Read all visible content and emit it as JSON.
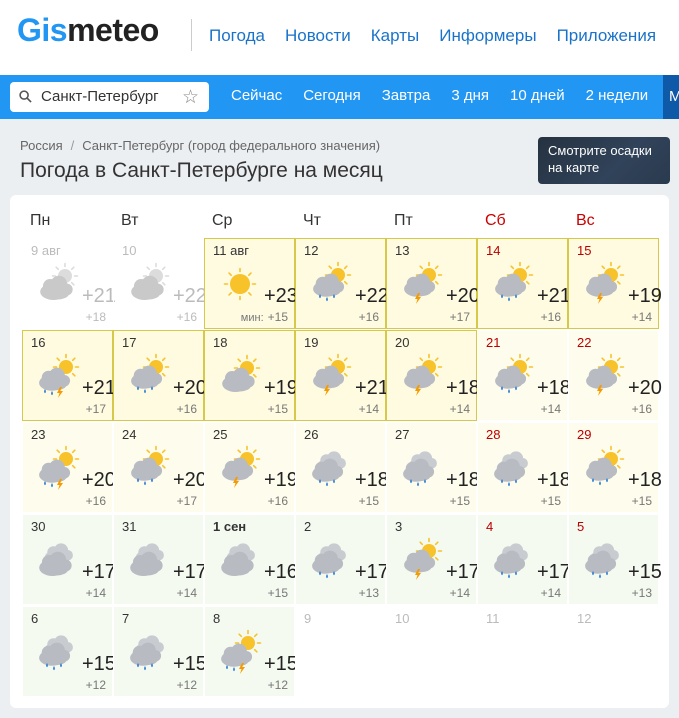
{
  "logo": {
    "part1": "Gis",
    "part2": "meteo"
  },
  "topnav": [
    "Погода",
    "Новости",
    "Карты",
    "Информеры",
    "Приложения"
  ],
  "search": {
    "value": "Санкт-Петербург"
  },
  "tabs": [
    "Сейчас",
    "Сегодня",
    "Завтра",
    "3 дня",
    "10 дней",
    "2 недели",
    "М"
  ],
  "breadcrumbs": [
    "Россия",
    "Санкт-Петербург (город федерального значения)"
  ],
  "title": "Погода в Санкт-Петербурге на месяц",
  "map_button": {
    "line1": "Смотрите осадки",
    "line2": "на карте"
  },
  "weekdays": [
    "Пн",
    "Вт",
    "Ср",
    "Чт",
    "Пт",
    "Сб",
    "Вс"
  ],
  "min_prefix": "мин:",
  "days": [
    {
      "d": "9 авг",
      "max": "+21",
      "min": "+18",
      "icon": "partly-cloudy-icon",
      "state": "past"
    },
    {
      "d": "10",
      "max": "+22",
      "min": "+16",
      "icon": "partly-cloudy-icon",
      "state": "past"
    },
    {
      "d": "11 авг",
      "max": "+23",
      "min": "+15",
      "icon": "sun-icon",
      "state": "today"
    },
    {
      "d": "12",
      "max": "+22",
      "min": "+16",
      "icon": "partly-cloudy-rain-icon",
      "state": "hl"
    },
    {
      "d": "13",
      "max": "+20",
      "min": "+17",
      "icon": "partly-cloudy-thunder-icon",
      "state": "hl"
    },
    {
      "d": "14",
      "max": "+21",
      "min": "+16",
      "icon": "partly-cloudy-rain-icon",
      "state": "hl",
      "we": true
    },
    {
      "d": "15",
      "max": "+19",
      "min": "+14",
      "icon": "partly-cloudy-thunder-icon",
      "state": "hl",
      "we": true
    },
    {
      "d": "16",
      "max": "+21",
      "min": "+17",
      "icon": "cloudy-sun-rain-thunder-icon",
      "state": "hl"
    },
    {
      "d": "17",
      "max": "+20",
      "min": "+16",
      "icon": "partly-cloudy-rain-icon",
      "state": "hl"
    },
    {
      "d": "18",
      "max": "+19",
      "min": "+15",
      "icon": "partly-cloudy-icon",
      "state": "hl"
    },
    {
      "d": "19",
      "max": "+21",
      "min": "+14",
      "icon": "partly-cloudy-thunder-icon",
      "state": "hl"
    },
    {
      "d": "20",
      "max": "+18",
      "min": "+14",
      "icon": "partly-cloudy-thunder-icon",
      "state": "hl"
    },
    {
      "d": "21",
      "max": "+18",
      "min": "+14",
      "icon": "partly-cloudy-rain-icon",
      "state": "yl",
      "we": true
    },
    {
      "d": "22",
      "max": "+20",
      "min": "+16",
      "icon": "partly-cloudy-thunder-icon",
      "state": "yl",
      "we": true
    },
    {
      "d": "23",
      "max": "+20",
      "min": "+16",
      "icon": "cloudy-sun-rain-thunder-icon",
      "state": "yl"
    },
    {
      "d": "24",
      "max": "+20",
      "min": "+17",
      "icon": "partly-cloudy-rain-icon",
      "state": "yl"
    },
    {
      "d": "25",
      "max": "+19",
      "min": "+16",
      "icon": "partly-cloudy-thunder-icon",
      "state": "yl"
    },
    {
      "d": "26",
      "max": "+18",
      "min": "+15",
      "icon": "cloudy-rain-icon",
      "state": "yl"
    },
    {
      "d": "27",
      "max": "+18",
      "min": "+15",
      "icon": "cloudy-rain-icon",
      "state": "yl"
    },
    {
      "d": "28",
      "max": "+18",
      "min": "+15",
      "icon": "cloudy-rain-icon",
      "state": "yl",
      "we": true
    },
    {
      "d": "29",
      "max": "+18",
      "min": "+15",
      "icon": "partly-cloudy-rain-icon",
      "state": "yl",
      "we": true
    },
    {
      "d": "30",
      "max": "+17",
      "min": "+14",
      "icon": "cloudy-icon",
      "state": "gr"
    },
    {
      "d": "31",
      "max": "+17",
      "min": "+14",
      "icon": "cloudy-icon",
      "state": "gr"
    },
    {
      "d": "1 сен",
      "max": "+16",
      "min": "+15",
      "icon": "cloudy-icon",
      "state": "gr",
      "bold": true
    },
    {
      "d": "2",
      "max": "+17",
      "min": "+13",
      "icon": "cloudy-rain-icon",
      "state": "gr"
    },
    {
      "d": "3",
      "max": "+17",
      "min": "+14",
      "icon": "partly-cloudy-thunder-icon",
      "state": "gr"
    },
    {
      "d": "4",
      "max": "+17",
      "min": "+14",
      "icon": "cloudy-rain-icon",
      "state": "gr",
      "we": true
    },
    {
      "d": "5",
      "max": "+15",
      "min": "+13",
      "icon": "cloudy-rain-icon",
      "state": "gr",
      "we": true
    },
    {
      "d": "6",
      "max": "+15",
      "min": "+12",
      "icon": "cloudy-rain-icon",
      "state": "gr"
    },
    {
      "d": "7",
      "max": "+15",
      "min": "+12",
      "icon": "cloudy-rain-icon",
      "state": "gr"
    },
    {
      "d": "8",
      "max": "+15",
      "min": "+12",
      "icon": "cloudy-sun-rain-thunder-icon",
      "state": "gr"
    },
    {
      "d": "9",
      "state": "empty"
    },
    {
      "d": "10",
      "state": "empty"
    },
    {
      "d": "11",
      "state": "empty"
    },
    {
      "d": "12",
      "state": "empty"
    }
  ],
  "colors": {
    "accent": "#2196f3",
    "weekend": "#bb0000",
    "highlight_border": "#d6c94a"
  }
}
